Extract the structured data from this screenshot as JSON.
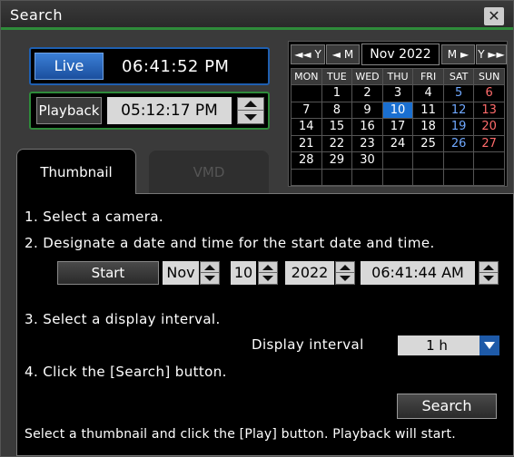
{
  "window": {
    "title": "Search",
    "close_glyph": "✕"
  },
  "live": {
    "button_label": "Live",
    "time": "06:41:52 PM"
  },
  "playback": {
    "label": "Playback",
    "time": "05:12:17 PM"
  },
  "calendar": {
    "nav": {
      "year_prev": "◄◄ Y",
      "month_prev": "◄ M",
      "month_next": "M ►",
      "year_next": "Y ►►"
    },
    "month_label": "Nov 2022",
    "weekdays": [
      "MON",
      "TUE",
      "WED",
      "THU",
      "FRI",
      "SAT",
      "SUN"
    ],
    "weeks": [
      [
        "",
        "1",
        "2",
        "3",
        "4",
        "5",
        "6"
      ],
      [
        "7",
        "8",
        "9",
        "10",
        "11",
        "12",
        "13"
      ],
      [
        "14",
        "15",
        "16",
        "17",
        "18",
        "19",
        "20"
      ],
      [
        "21",
        "22",
        "23",
        "24",
        "25",
        "26",
        "27"
      ],
      [
        "28",
        "29",
        "30",
        "",
        "",
        "",
        ""
      ],
      [
        "",
        "",
        "",
        "",
        "",
        "",
        ""
      ]
    ],
    "selected_day": "10",
    "colors": {
      "saturday": "#6fa8ff",
      "sunday": "#ff6b6b",
      "selected": "#1a6fd0"
    }
  },
  "tabs": [
    {
      "label": "Thumbnail",
      "active": true
    },
    {
      "label": "VMD",
      "active": false
    }
  ],
  "steps": {
    "step1": "1. Select a camera.",
    "step2": "2. Designate a date and time for the start date and time.",
    "step3": "3. Select a display interval.",
    "step4": "4. Click the [Search] button."
  },
  "start": {
    "button_label": "Start",
    "month": "Nov",
    "day": "10",
    "year": "2022",
    "time": "06:41:44 AM"
  },
  "display_interval": {
    "label": "Display interval",
    "value": "1 h"
  },
  "search_button": "Search",
  "footer": "Select a thumbnail and click the [Play] button. Playback will start."
}
